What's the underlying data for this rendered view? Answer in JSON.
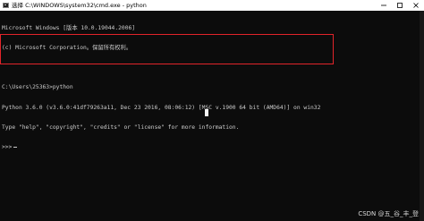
{
  "window": {
    "title": "选择 C:\\WINDOWS\\system32\\cmd.exe - python",
    "icon": "cmd-icon",
    "controls": [
      "minimize-icon",
      "maximize-icon",
      "close-icon"
    ]
  },
  "console": {
    "lines": [
      "Microsoft Windows [版本 10.0.19044.2006]",
      "(c) Microsoft Corporation。保留所有权利。",
      "",
      "C:\\Users\\25363>python",
      "Python 3.6.0 (v3.6.0:41df79263a11, Dec 23 2016, 08:06:12) [MSC v.1900 64 bit (AMD64)] on win32",
      "Type \"help\", \"copyright\", \"credits\" or \"license\" for more information.",
      ">>>"
    ]
  },
  "colors": {
    "console_bg": "#0c0c0c",
    "console_text": "#cccccc",
    "highlight_border": "#e2242a",
    "titlebar_bg": "#ffffff"
  },
  "watermark": "CSDN @五_谷_丰_登"
}
